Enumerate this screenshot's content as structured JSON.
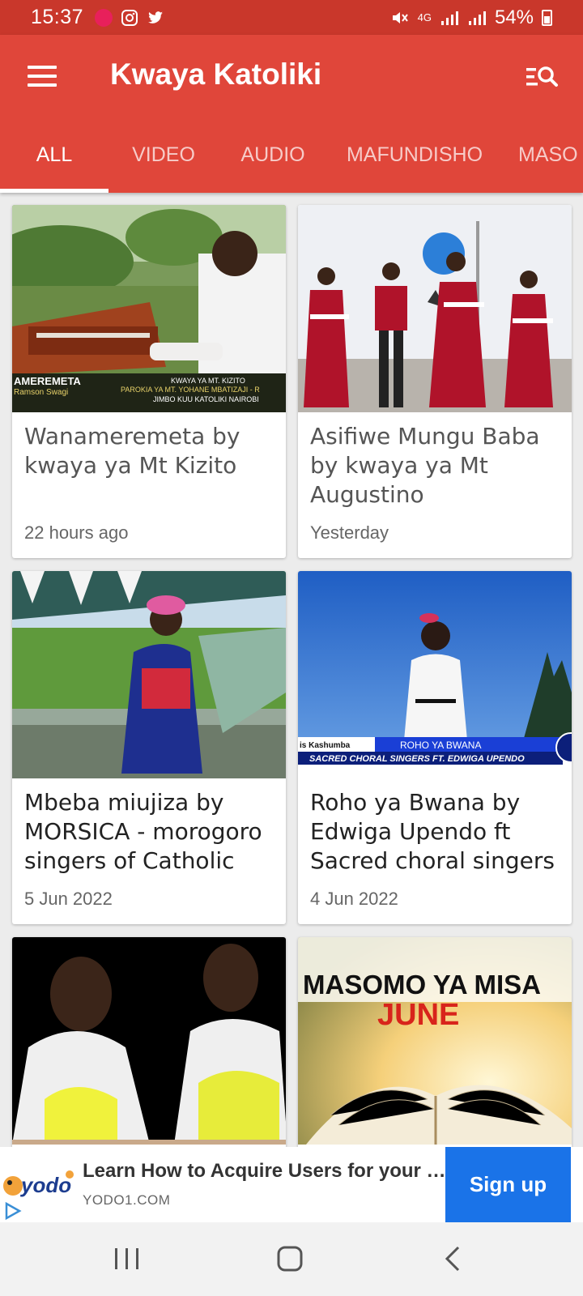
{
  "status_bar": {
    "time": "15:37",
    "network": "4G",
    "battery": "54%"
  },
  "app_bar": {
    "title": "Kwaya Katoliki"
  },
  "tabs": [
    {
      "label": "ALL",
      "active": true
    },
    {
      "label": "VIDEO"
    },
    {
      "label": "AUDIO"
    },
    {
      "label": "MAFUNDISHO"
    },
    {
      "label": "MASO"
    }
  ],
  "cards": [
    {
      "title": "Wanameremeta by kwaya ya Mt Kizito",
      "time": "22 hours ago",
      "thumb_caption": {
        "left_big": "AMEREMETA",
        "left_small": "Ramson Swagi",
        "line1": "KWAYA YA MT. KIZITO",
        "line2": "PAROKIA YA MT. YOHANE MBATIZAJI - R",
        "line3": "JIMBO KUU KATOLIKI  NAIROBI"
      }
    },
    {
      "title": "Asifiwe Mungu Baba by kwaya ya Mt Augustino",
      "time": "Yesterday"
    },
    {
      "title": "Mbeba miujiza by MORSICA - morogoro singers of Catholic",
      "time": "5 Jun 2022"
    },
    {
      "title": "Roho ya Bwana by Edwiga Upendo ft Sacred choral singers",
      "time": "4 Jun 2022",
      "thumb_caption": {
        "left": "is Kashumba",
        "line1": "ROHO YA BWANA",
        "line2": "SACRED CHORAL SINGERS FT.  EDWIGA UPENDO"
      }
    },
    {
      "title": "",
      "time": ""
    },
    {
      "title": "",
      "time": "",
      "thumb_caption": {
        "line1": "MASOMO YA MISA",
        "line2": "JUNE"
      }
    }
  ],
  "ad": {
    "logo_text": "yodo",
    "headline": "Learn How to Acquire Users for your …",
    "domain": "YODO1.COM",
    "cta": "Sign up"
  },
  "colors": {
    "primary": "#e0463a",
    "primary_dark": "#c9372b",
    "ad_button": "#1a73e8"
  }
}
